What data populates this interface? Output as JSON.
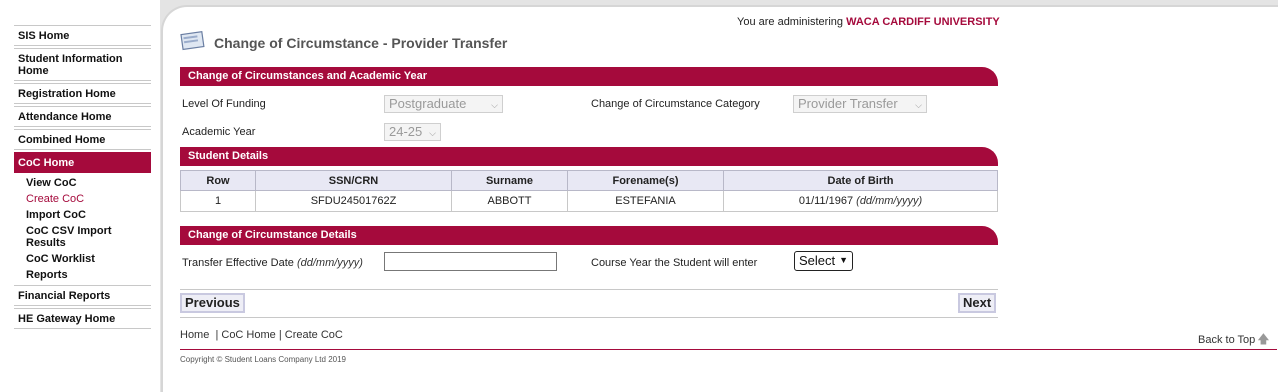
{
  "sidebar": {
    "items": [
      {
        "label": "SIS Home"
      },
      {
        "label": "Student Information Home"
      },
      {
        "label": "Registration Home"
      },
      {
        "label": "Attendance Home"
      },
      {
        "label": "Combined Home"
      },
      {
        "label": "CoC Home"
      },
      {
        "label": "Financial Reports"
      },
      {
        "label": "HE Gateway Home"
      }
    ],
    "sub_items": [
      {
        "label": "View CoC"
      },
      {
        "label": "Create CoC"
      },
      {
        "label": "Import CoC"
      },
      {
        "label": "CoC CSV Import Results"
      },
      {
        "label": "CoC Worklist"
      },
      {
        "label": "Reports"
      }
    ]
  },
  "header": {
    "admin_prefix": "You are administering",
    "admin_org": "WACA CARDIFF UNIVERSITY",
    "title": "Change of Circumstance - Provider Transfer"
  },
  "section1": {
    "title": "Change of Circumstances and Academic Year",
    "funding_label": "Level Of Funding",
    "funding_value": "Postgraduate",
    "category_label": "Change of Circumstance Category",
    "category_value": "Provider Transfer",
    "year_label": "Academic Year",
    "year_value": "24-25"
  },
  "section2": {
    "title": "Student Details",
    "columns": [
      "Row",
      "SSN/CRN",
      "Surname",
      "Forename(s)",
      "Date of Birth"
    ],
    "rows": [
      {
        "row": "1",
        "ssn": "SFDU24501762Z",
        "surname": "ABBOTT",
        "forename": "ESTEFANIA",
        "dob": "01/11/1967",
        "dob_format": "(dd/mm/yyyy)"
      }
    ]
  },
  "section3": {
    "title": "Change of Circumstance Details",
    "date_label": "Transfer Effective Date",
    "date_format": "(dd/mm/yyyy)",
    "date_value": "",
    "course_year_label": "Course Year the Student will enter",
    "course_year_value": "Select"
  },
  "buttons": {
    "previous": "Previous",
    "next": "Next"
  },
  "footer": {
    "links": [
      "Home",
      "CoC Home",
      "Create CoC"
    ],
    "back_to_top": "Back to Top",
    "copyright": "Copyright © Student Loans Company Ltd 2019"
  }
}
